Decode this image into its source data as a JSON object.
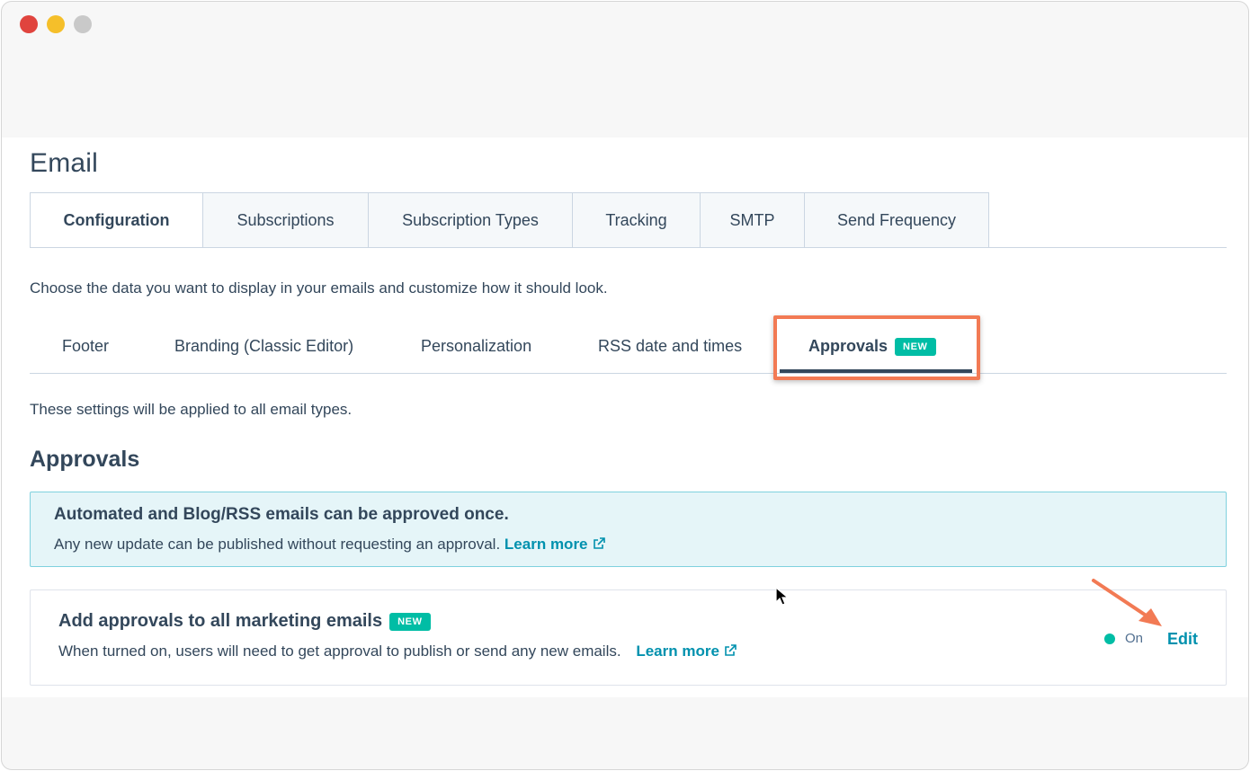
{
  "page": {
    "title": "Email"
  },
  "main_tabs": [
    {
      "label": "Configuration",
      "active": true
    },
    {
      "label": "Subscriptions",
      "active": false
    },
    {
      "label": "Subscription Types",
      "active": false
    },
    {
      "label": "Tracking",
      "active": false
    },
    {
      "label": "SMTP",
      "active": false
    },
    {
      "label": "Send Frequency",
      "active": false
    }
  ],
  "configuration": {
    "description": "Choose the data you want to display in your emails and customize how it should look."
  },
  "sub_tabs": [
    {
      "label": "Footer",
      "active": false
    },
    {
      "label": "Branding (Classic Editor)",
      "active": false
    },
    {
      "label": "Personalization",
      "active": false
    },
    {
      "label": "RSS date and times",
      "active": false
    },
    {
      "label": "Approvals",
      "active": true,
      "badge": "NEW"
    }
  ],
  "approvals": {
    "applied_note": "These settings will be applied to all email types.",
    "section_title": "Approvals",
    "info": {
      "title": "Automated and Blog/RSS emails can be approved once.",
      "text": "Any new update can be published without requesting an approval.",
      "link": "Learn more"
    },
    "setting": {
      "title": "Add approvals to all marketing emails",
      "badge": "NEW",
      "description": "When turned on, users will need to get approval to publish or send any new emails.",
      "link": "Learn more",
      "status": "On",
      "edit_label": "Edit"
    }
  },
  "colors": {
    "accent": "#0091ae",
    "badge": "#00bda5",
    "highlight": "#f27a54",
    "info_background": "#e5f5f8",
    "text": "#33475b"
  }
}
